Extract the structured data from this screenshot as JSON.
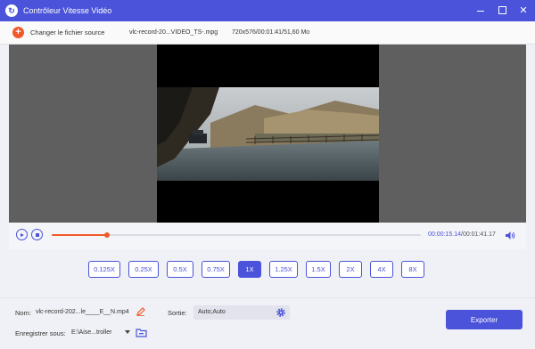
{
  "window": {
    "title": "Contrôleur Vitesse Vidéo"
  },
  "source": {
    "change_label": "Changer le fichier source",
    "file_name": "vlc-record-20...VIDEO_TS-.mpg",
    "file_meta": "720x576/00:01:41/51,60 Mo"
  },
  "player": {
    "current_time": "00:00:15.14",
    "separator": "/",
    "total_time": "00:01:41.17",
    "progress_fraction": 0.15
  },
  "speeds": {
    "options": [
      "0.125X",
      "0.25X",
      "0.5X",
      "0.75X",
      "1X",
      "1.25X",
      "1.5X",
      "2X",
      "4X",
      "8X"
    ],
    "selected": "1X"
  },
  "output": {
    "name_label": "Nom:",
    "name_value": "vlc-record-202...le____E__N.mp4",
    "sortie_label": "Sortie:",
    "sortie_value": "Auto;Auto",
    "save_label": "Enregistrer sous:",
    "save_path": "E:\\Aise...troller",
    "export_label": "Exporter"
  },
  "colors": {
    "accent": "#4a53d9",
    "progress": "#f05a2a"
  }
}
